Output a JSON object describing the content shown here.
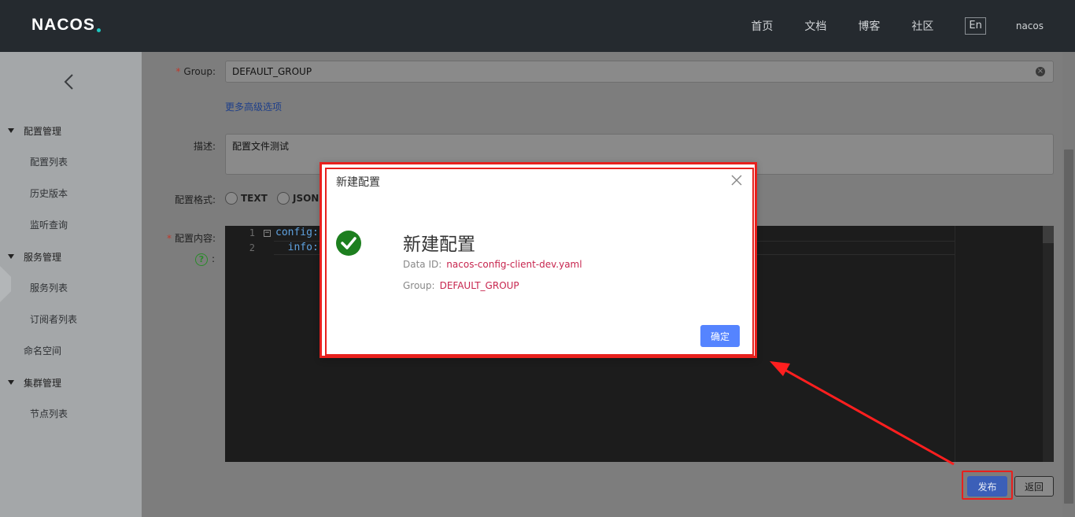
{
  "header": {
    "logo": "NACOS",
    "nav": [
      "首页",
      "文档",
      "博客",
      "社区"
    ],
    "lang": "En",
    "user": "nacos"
  },
  "sidebar": {
    "groups": [
      {
        "label": "配置管理",
        "items": [
          "配置列表",
          "历史版本",
          "监听查询"
        ]
      },
      {
        "label": "服务管理",
        "items": [
          "服务列表",
          "订阅者列表"
        ]
      },
      {
        "label": "命名空间",
        "items": []
      },
      {
        "label": "集群管理",
        "items": [
          "节点列表"
        ]
      }
    ]
  },
  "form": {
    "group_label": "Group:",
    "group_value": "DEFAULT_GROUP",
    "advanced_link": "更多高级选项",
    "desc_label": "描述:",
    "desc_value": "配置文件测试",
    "format_label": "配置格式:",
    "formats": [
      "TEXT",
      "JSON"
    ],
    "content_label": "配置内容:",
    "help_colon": ":",
    "required_mark": "*"
  },
  "editor": {
    "lines": [
      {
        "num": "1",
        "text": "config:"
      },
      {
        "num": "2",
        "text": "  info:"
      }
    ]
  },
  "buttons": {
    "publish": "发布",
    "back": "返回"
  },
  "dialog": {
    "title": "新建配置",
    "heading": "新建配置",
    "data_id_label": "Data ID:",
    "data_id_value": "nacos-config-client-dev.yaml",
    "group_label": "Group:",
    "group_value": "DEFAULT_GROUP",
    "ok": "确定"
  },
  "colors": {
    "header_bg": "#252a2f",
    "annotation_red": "#e8201d",
    "primary": "#5584ff",
    "success": "#1d7f1f"
  }
}
